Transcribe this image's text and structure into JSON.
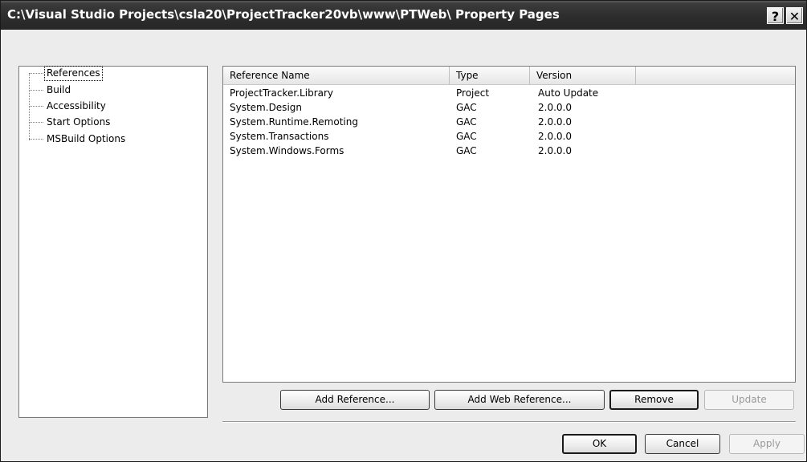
{
  "window": {
    "title": "C:\\Visual Studio Projects\\csla20\\ProjectTracker20vb\\www\\PTWeb\\ Property Pages",
    "help_glyph": "?",
    "close_glyph": "✕"
  },
  "tree": {
    "items": [
      {
        "label": "References",
        "selected": true
      },
      {
        "label": "Build"
      },
      {
        "label": "Accessibility"
      },
      {
        "label": "Start Options"
      },
      {
        "label": "MSBuild Options"
      }
    ]
  },
  "references": {
    "columns": [
      "Reference Name",
      "Type",
      "Version"
    ],
    "rows": [
      [
        "ProjectTracker.Library",
        "Project",
        "Auto Update"
      ],
      [
        "System.Design",
        "GAC",
        "2.0.0.0"
      ],
      [
        "System.Runtime.Remoting",
        "GAC",
        "2.0.0.0"
      ],
      [
        "System.Transactions",
        "GAC",
        "2.0.0.0"
      ],
      [
        "System.Windows.Forms",
        "GAC",
        "2.0.0.0"
      ]
    ]
  },
  "ref_buttons": {
    "add_reference": "Add Reference...",
    "add_web_reference": "Add Web Reference...",
    "remove": "Remove",
    "update": "Update"
  },
  "dialog_buttons": {
    "ok": "OK",
    "cancel": "Cancel",
    "apply": "Apply"
  }
}
